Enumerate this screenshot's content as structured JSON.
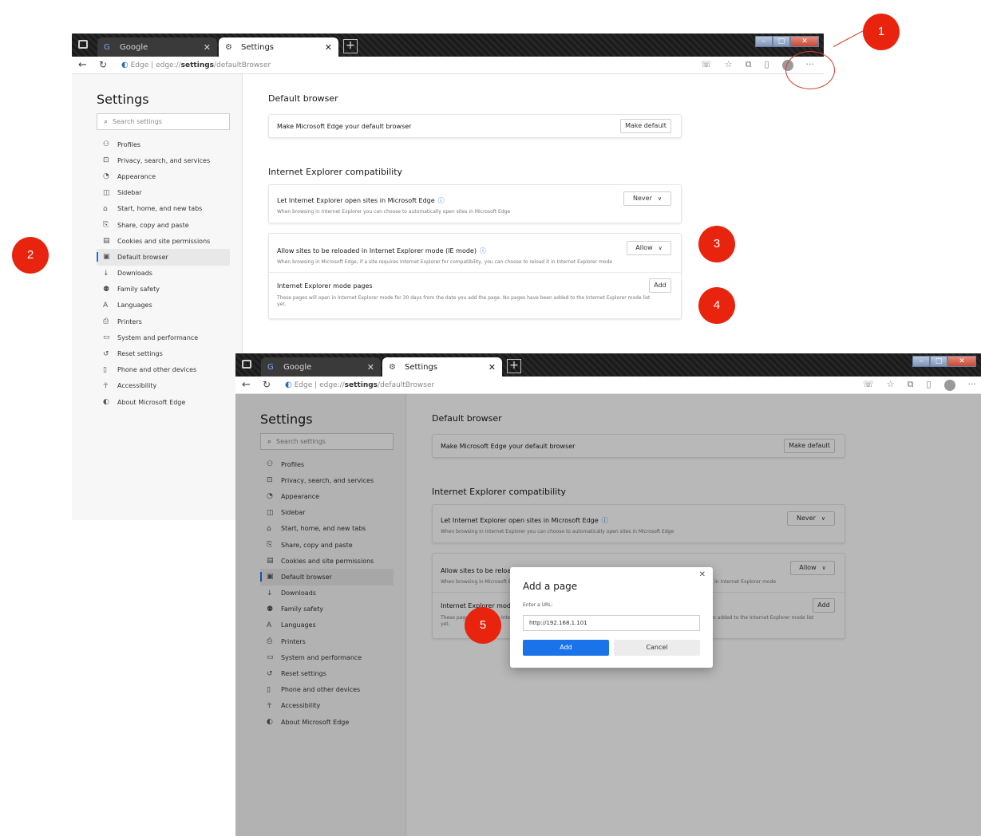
{
  "colors": {
    "accent": "#1a73e8",
    "marker": "#e8240e",
    "overlay": "#bdbdbd"
  },
  "tabs": {
    "google": {
      "icon": "google-icon",
      "label": "Google",
      "close": "✕"
    },
    "settings": {
      "icon": "gear-icon",
      "label": "Settings",
      "close": "✕"
    },
    "new_tab": "+"
  },
  "window_controls": {
    "minimize": "–",
    "maximize": "□",
    "close": "✕"
  },
  "address": {
    "brand": "Edge",
    "separator": "|",
    "url_prefix": "edge://",
    "url_bold": "settings",
    "url_suffix": "/defaultBrowser"
  },
  "toolbar": {
    "more": "···"
  },
  "sidebar": {
    "title": "Settings",
    "search_placeholder": "Search settings",
    "items": [
      {
        "label": "Profiles",
        "icon": "profile-icon"
      },
      {
        "label": "Privacy, search, and services",
        "icon": "lock-icon"
      },
      {
        "label": "Appearance",
        "icon": "appearance-icon"
      },
      {
        "label": "Sidebar",
        "icon": "sidebar-icon"
      },
      {
        "label": "Start, home, and new tabs",
        "icon": "home-icon"
      },
      {
        "label": "Share, copy and paste",
        "icon": "share-icon"
      },
      {
        "label": "Cookies and site permissions",
        "icon": "cookie-icon"
      },
      {
        "label": "Default browser",
        "icon": "browser-icon",
        "selected": true
      },
      {
        "label": "Downloads",
        "icon": "download-icon"
      },
      {
        "label": "Family safety",
        "icon": "family-icon"
      },
      {
        "label": "Languages",
        "icon": "language-icon"
      },
      {
        "label": "Printers",
        "icon": "printer-icon"
      },
      {
        "label": "System and performance",
        "icon": "system-icon"
      },
      {
        "label": "Reset settings",
        "icon": "reset-icon"
      },
      {
        "label": "Phone and other devices",
        "icon": "phone-icon"
      },
      {
        "label": "Accessibility",
        "icon": "accessibility-icon"
      },
      {
        "label": "About Microsoft Edge",
        "icon": "edge-icon"
      }
    ]
  },
  "main": {
    "default_browser": {
      "heading": "Default browser",
      "row_title": "Make Microsoft Edge your default browser",
      "button": "Make default"
    },
    "ie_compat": {
      "heading": "Internet Explorer compatibility",
      "let_ie": {
        "title": "Let Internet Explorer open sites in Microsoft Edge",
        "desc": "When browsing in Internet Explorer you can choose to automatically open sites in Microsoft Edge",
        "value": "Never"
      },
      "allow_reload": {
        "title": "Allow sites to be reloaded in Internet Explorer mode (IE mode)",
        "desc": "When browsing in Microsoft Edge, if a site requires Internet Explorer for compatibility, you can choose to reload it in Internet Explorer mode",
        "value": "Allow"
      },
      "ie_pages": {
        "title": "Internet Explorer mode pages",
        "desc": "These pages will open in Internet Explorer mode for 30 days from the date you add the page. No pages have been added to the Internet Explorer mode list yet.",
        "button": "Add"
      }
    }
  },
  "dialog": {
    "title": "Add a page",
    "label": "Enter a URL:",
    "value": "http://192.168.1.101",
    "add": "Add",
    "cancel": "Cancel",
    "close": "✕"
  },
  "markers": [
    "1",
    "2",
    "3",
    "4",
    "5"
  ]
}
